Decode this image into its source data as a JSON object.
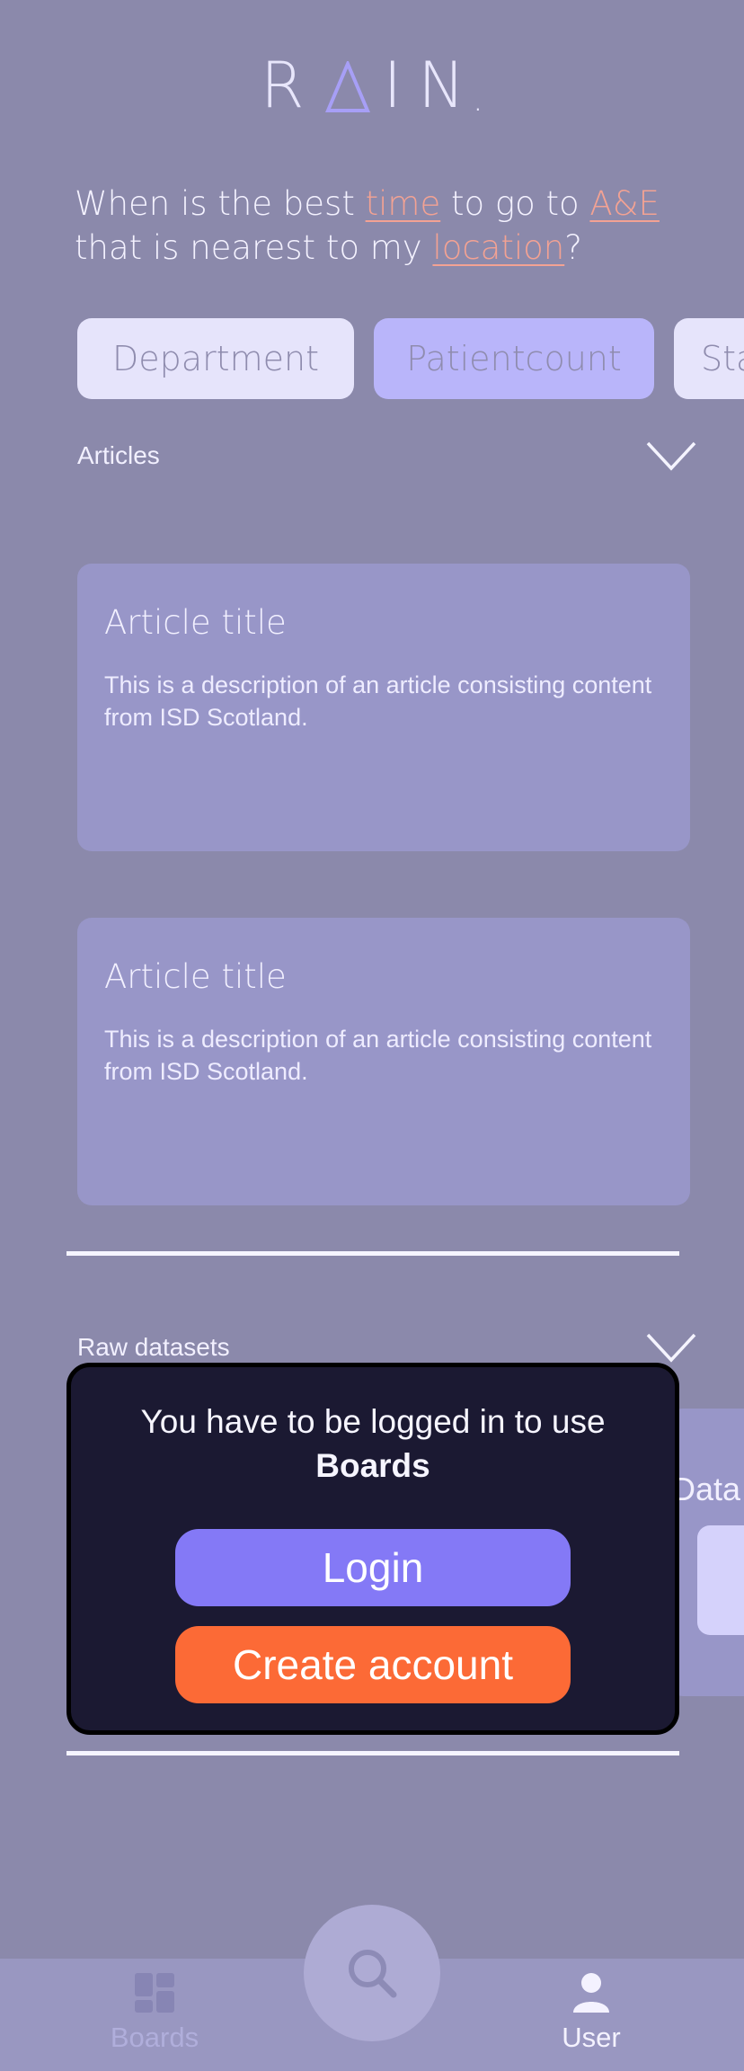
{
  "logo": {
    "text_r": "R",
    "text_rest": "IN",
    "text_dot": ".",
    "icon": "triangle-a-icon"
  },
  "question": {
    "part1": "When is the best ",
    "hl1": "time",
    "part2": " to go to ",
    "hl2": "A&E",
    "part3": " that is nearest to my ",
    "hl3": "location",
    "part4": "?"
  },
  "chips": [
    {
      "label": "Department"
    },
    {
      "label": "Patientcount"
    },
    {
      "label": "Sta"
    }
  ],
  "articles_section": {
    "label": "Articles",
    "icon": "chevron-down-icon",
    "cards": [
      {
        "title": "Article title",
        "description": "This is a description of an article consisting content from ISD Scotland."
      },
      {
        "title": "Article title",
        "description": "This is a description of an article consisting content from ISD Scotland."
      }
    ]
  },
  "raw_section": {
    "label": "Raw datasets",
    "icon": "chevron-down-icon",
    "peek_text": "Data"
  },
  "modal": {
    "message_prefix": "You have to be logged in to use ",
    "message_bold": "Boards",
    "login_label": "Login",
    "create_label": "Create account"
  },
  "bottom_nav": {
    "boards_label": "Boards",
    "user_label": "User",
    "search_icon": "search-icon"
  },
  "colors": {
    "background": "#8b89ab",
    "highlight": "#f3a293",
    "login_button": "#8479f6",
    "create_button": "#fc6a36",
    "modal_bg": "#1b1932"
  }
}
